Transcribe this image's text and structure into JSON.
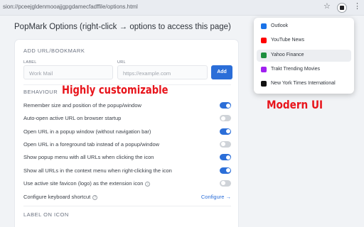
{
  "browser": {
    "url": "sion://pceejgldenmooajjgpgdamecfadffile/options.html",
    "bookmark_icon": "star-icon",
    "extension_icon": "popmark-icon",
    "menu_icon": "kebab-menu-icon"
  },
  "page": {
    "title": "PopMark Options (right-click → options to access this page)"
  },
  "add_url": {
    "section_title": "ADD URL/BOOKMARK",
    "label_caption": "LABEL",
    "label_placeholder": "Work Mail",
    "url_caption": "URL",
    "url_placeholder": "https://example.com",
    "add_button": "Add"
  },
  "behaviour": {
    "section_title": "BEHAVIOUR",
    "options": [
      {
        "label": "Remember size and position of the popup/window",
        "enabled": true
      },
      {
        "label": "Auto-open active URL on browser startup",
        "enabled": false
      },
      {
        "label": "Open URL in a popup window (without navigation bar)",
        "enabled": true
      },
      {
        "label": "Open URL in a foreground tab instead of a popup/window",
        "enabled": false
      },
      {
        "label": "Show popup menu with all URLs when clicking the icon",
        "enabled": true
      },
      {
        "label": "Show all URLs in the context menu when right-clicking the icon",
        "enabled": true
      },
      {
        "label": "Use active site favicon (logo) as the extension icon",
        "enabled": false,
        "info": "i"
      }
    ],
    "shortcut_label": "Configure keyboard shortcut",
    "shortcut_info": "?",
    "configure_link": "Configure →"
  },
  "label_on_icon": {
    "section_title": "LABEL ON ICON"
  },
  "promo": {
    "customizable": "Highly customizable",
    "modern": "Modern UI"
  },
  "popup_menu": {
    "items": [
      {
        "label": "Outlook",
        "icon": "outlook-icon",
        "color": "#1a73e8",
        "highlighted": false
      },
      {
        "label": "YouTube News",
        "icon": "youtube-icon",
        "color": "#ff0000",
        "highlighted": false
      },
      {
        "label": "Yahoo Finance",
        "icon": "yahoo-finance-icon",
        "color": "#1e8e3e",
        "highlighted": true
      },
      {
        "label": "Trakt Trending Movies",
        "icon": "trakt-icon",
        "color": "#a020f0",
        "highlighted": false
      },
      {
        "label": "New York Times International",
        "icon": "nyt-icon",
        "color": "#111111",
        "highlighted": false
      }
    ]
  }
}
